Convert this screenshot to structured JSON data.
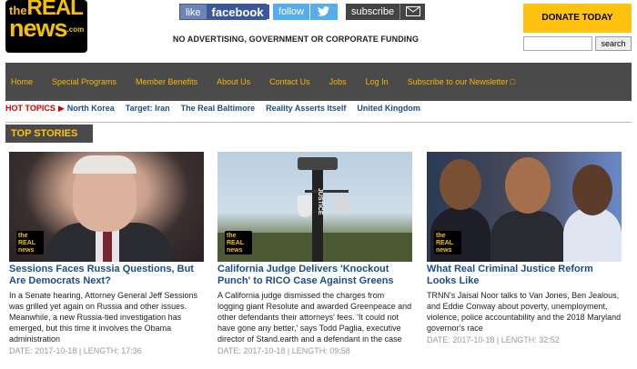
{
  "brand": {
    "logo_top": "the",
    "logo_real": "REAL",
    "logo_news": "news",
    "logo_com": ".com",
    "colors": {
      "accent": "#ffc20e",
      "nav_bg": "#4a4a4a",
      "link": "#1a4d8c",
      "hot": "#cc0000"
    }
  },
  "social": {
    "facebook_label": "like",
    "facebook_name": "facebook",
    "twitter_label": "follow",
    "twitter_icon": "twitter-bird-icon",
    "subscribe_label": "subscribe",
    "subscribe_icon": "envelope-icon"
  },
  "tagline": "NO ADVERTISING, GOVERNMENT OR CORPORATE FUNDING",
  "donate_label": "DONATE TODAY",
  "search": {
    "value": "",
    "button": "search"
  },
  "nav": [
    "Home",
    "Special Programs",
    "Member Benefits",
    "About Us",
    "Contact Us",
    "Jobs",
    "Log In",
    "Subscribe to our Newsletter □"
  ],
  "hot_topics": {
    "label": "HOT TOPICS",
    "arrow": "▶",
    "items": [
      "North Korea",
      "Target: Iran",
      "The Real Baltimore",
      "Reality Asserts Itself",
      "United Kingdom"
    ]
  },
  "top_stories_label": "TOP STORIES",
  "stories": [
    {
      "title": "Sessions Faces Russia Questions, But Are Democrats Next?",
      "summary": "In a Senate hearing, Attorney General Jeff Sessions was grilled yet again on Russia and other issues. Meanwhile, a new Russia-tied investigation has emerged, but this time it involves the Obama administration",
      "meta": "DATE: 2017-10-18 | LENGTH: 17:36"
    },
    {
      "title": "California Judge Delivers 'Knockout Punch' to RICO Case Against Greens",
      "summary": "A California judge dismissed the charges from logging giant Resolute and awarded Greenpeace and other defendants their attorneys' fees. 'It could not have gone any better,' says Todd Paglia, executive director of Stand.earth and a defendant in the case",
      "meta": "DATE: 2017-10-18 | LENGTH: 09:58"
    },
    {
      "title": "What Real Criminal Justice Reform Looks Like",
      "summary": "TRNN's Jaisal Noor talks to Van Jones, Ben Jealous, and Eddie Conway about poverty, unemployment, violence, police accountability and the 2018 Maryland governor's race",
      "meta": "DATE: 2017-10-18 | LENGTH: 32:52"
    }
  ],
  "image_badge": {
    "l1": "the",
    "l2": "REAL",
    "l3": "news"
  },
  "image2_sign": "JUSTICE"
}
